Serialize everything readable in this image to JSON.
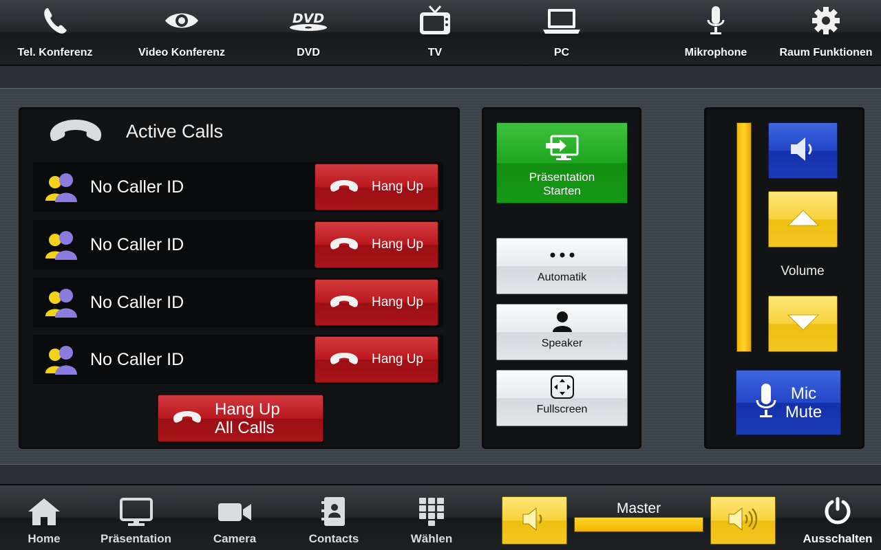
{
  "top_nav": [
    {
      "label": "Tel. Konferenz",
      "icon": "phone-icon"
    },
    {
      "label": "Video Konferenz",
      "icon": "eye-icon"
    },
    {
      "label": "DVD",
      "icon": "dvd-icon"
    },
    {
      "label": "TV",
      "icon": "tv-icon"
    },
    {
      "label": "PC",
      "icon": "laptop-icon"
    },
    {
      "label": "Mikrophone",
      "icon": "microphone-icon"
    },
    {
      "label": "Raum Funktionen",
      "icon": "gear-icon"
    }
  ],
  "active_calls": {
    "title": "Active Calls",
    "calls": [
      {
        "caller": "No Caller ID",
        "hangup_label": "Hang Up"
      },
      {
        "caller": "No Caller ID",
        "hangup_label": "Hang Up"
      },
      {
        "caller": "No Caller ID",
        "hangup_label": "Hang Up"
      },
      {
        "caller": "No Caller ID",
        "hangup_label": "Hang Up"
      }
    ],
    "hangup_all_line1": "Hang Up",
    "hangup_all_line2": "All Calls"
  },
  "center": {
    "presentation_label": "Präsentation\nStarten",
    "automatik_label": "Automatik",
    "speaker_label": "Speaker",
    "fullscreen_label": "Fullscreen"
  },
  "volume": {
    "label": "Volume",
    "level": 1.0,
    "mic_mute_label": "Mic\nMute"
  },
  "bottom_nav": [
    {
      "label": "Home",
      "icon": "home-icon"
    },
    {
      "label": "Präsentation",
      "icon": "monitor-icon"
    },
    {
      "label": "Camera",
      "icon": "camera-icon"
    },
    {
      "label": "Contacts",
      "icon": "contacts-icon"
    },
    {
      "label": "Wählen",
      "icon": "keypad-icon"
    }
  ],
  "master": {
    "label": "Master",
    "level": 1.0,
    "power_label": "Ausschalten"
  },
  "colors": {
    "hangup_red": "#b8181e",
    "presentation_green": "#1fa51f",
    "volume_blue": "#2346c8",
    "volume_yellow": "#f8d23c"
  }
}
